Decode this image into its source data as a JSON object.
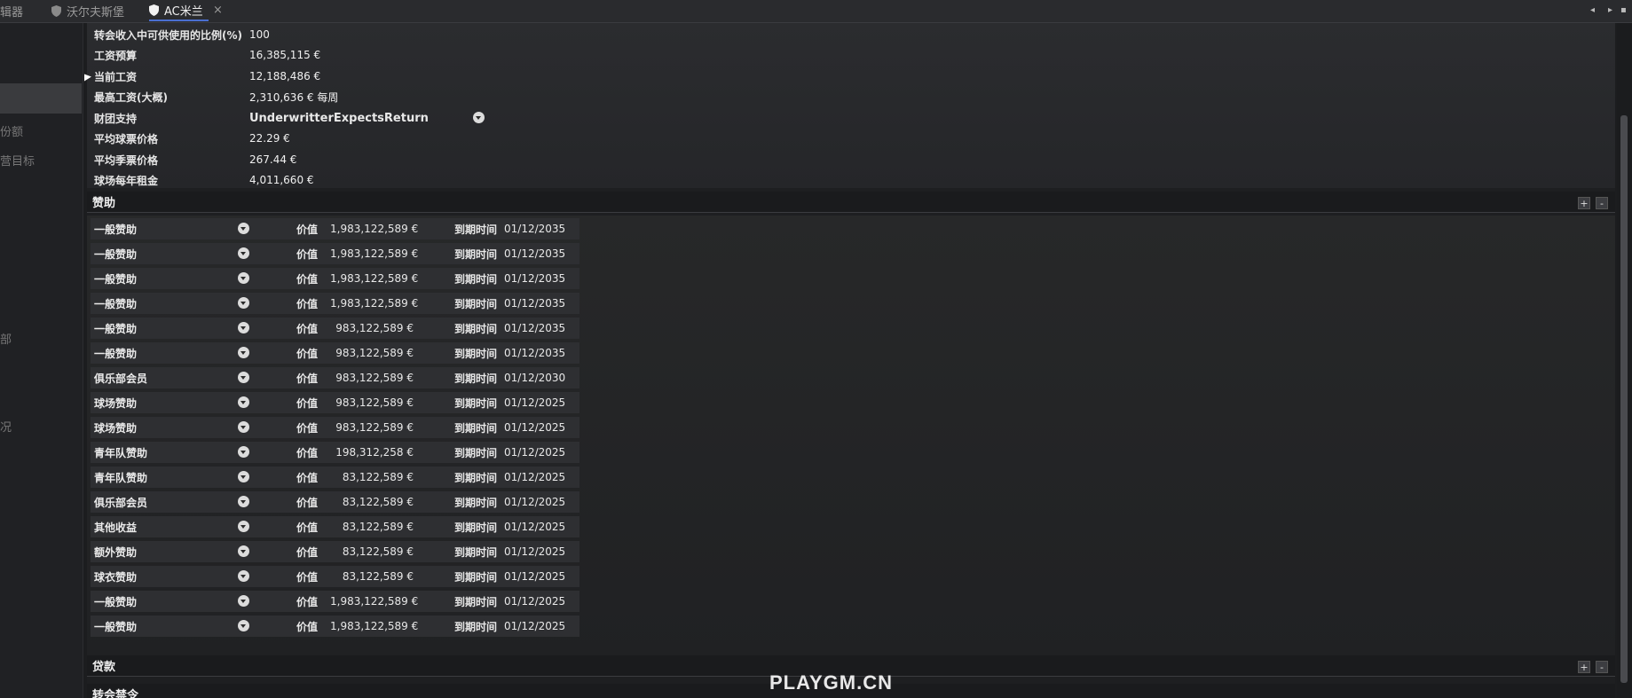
{
  "tabs": [
    {
      "label": "辑器"
    },
    {
      "label": "沃尔夫斯堡"
    },
    {
      "label": "AC米兰",
      "close": "×"
    }
  ],
  "tab_nav": {
    "prev": "◂",
    "next": "▸",
    "menu": "▪"
  },
  "sidebar": {
    "items": [
      {
        "label": "份额"
      },
      {
        "label": "营目标"
      },
      {
        "label": "部"
      },
      {
        "label": "况"
      }
    ]
  },
  "finance": {
    "rows": [
      {
        "label": "转会收入中可供使用的比例(%)",
        "value": "100"
      },
      {
        "label": "工资预算",
        "value": "16,385,115 €"
      },
      {
        "label": "当前工资",
        "value": "12,188,486 €"
      },
      {
        "label": "最高工资(大概)",
        "value": "2,310,636 € 每周"
      },
      {
        "label": "财团支持",
        "value": ""
      },
      {
        "label": "平均球票价格",
        "value": "22.29 €"
      },
      {
        "label": "平均季票价格",
        "value": "267.44 €"
      },
      {
        "label": "球场每年租金",
        "value": "4,011,660 €"
      }
    ],
    "underwriter": "UnderwritterExpectsReturn"
  },
  "sections": {
    "sponsorship": "赞助",
    "loans": "贷款",
    "transfer_ban": "转会禁令",
    "add": "+",
    "remove": "-"
  },
  "sponsor_labels": {
    "value": "价值",
    "expiry": "到期时间"
  },
  "sponsors": [
    {
      "type": "一般赞助",
      "value": "1,983,122,589 €",
      "date": "01/12/2035"
    },
    {
      "type": "一般赞助",
      "value": "1,983,122,589 €",
      "date": "01/12/2035"
    },
    {
      "type": "一般赞助",
      "value": "1,983,122,589 €",
      "date": "01/12/2035"
    },
    {
      "type": "一般赞助",
      "value": "1,983,122,589 €",
      "date": "01/12/2035"
    },
    {
      "type": "一般赞助",
      "value": "983,122,589 €",
      "date": "01/12/2035"
    },
    {
      "type": "一般赞助",
      "value": "983,122,589 €",
      "date": "01/12/2035"
    },
    {
      "type": "俱乐部会员",
      "value": "983,122,589 €",
      "date": "01/12/2030"
    },
    {
      "type": "球场赞助",
      "value": "983,122,589 €",
      "date": "01/12/2025"
    },
    {
      "type": "球场赞助",
      "value": "983,122,589 €",
      "date": "01/12/2025"
    },
    {
      "type": "青年队赞助",
      "value": "198,312,258 €",
      "date": "01/12/2025"
    },
    {
      "type": "青年队赞助",
      "value": "83,122,589 €",
      "date": "01/12/2025"
    },
    {
      "type": "俱乐部会员",
      "value": "83,122,589 €",
      "date": "01/12/2025"
    },
    {
      "type": "其他收益",
      "value": "83,122,589 €",
      "date": "01/12/2025"
    },
    {
      "type": "额外赞助",
      "value": "83,122,589 €",
      "date": "01/12/2025"
    },
    {
      "type": "球衣赞助",
      "value": "83,122,589 €",
      "date": "01/12/2025"
    },
    {
      "type": "一般赞助",
      "value": "1,983,122,589 €",
      "date": "01/12/2025"
    },
    {
      "type": "一般赞助",
      "value": "1,983,122,589 €",
      "date": "01/12/2025"
    }
  ],
  "watermark": "PLAYGM.CN"
}
